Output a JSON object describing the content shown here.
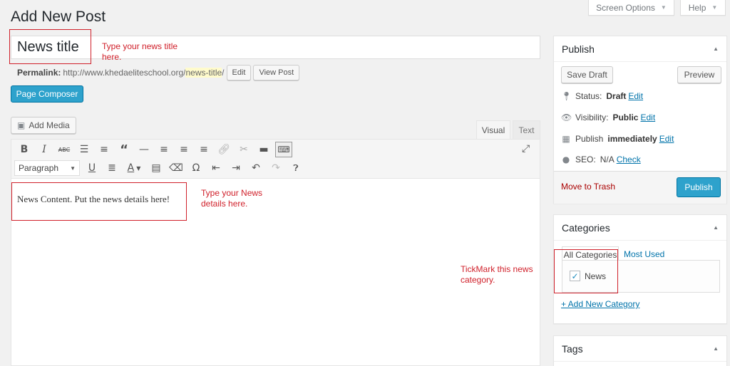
{
  "header": {
    "page_title": "Add New Post",
    "screen_options": "Screen Options",
    "help": "Help"
  },
  "post": {
    "title_value": "News title",
    "permalink_label": "Permalink:",
    "permalink_base": "http://www.khedaeliteschool.org/",
    "permalink_slug": "news-title",
    "permalink_trailing": "/",
    "edit_label": "Edit",
    "view_post_label": "View Post"
  },
  "page_composer": "Page Composer",
  "editor": {
    "add_media": "Add Media",
    "tab_visual": "Visual",
    "tab_text": "Text",
    "format_select": "Paragraph",
    "content": "News Content. Put the news details here!"
  },
  "annotations": {
    "title_note": "Type your news title here.",
    "content_note": "Type your News details here.",
    "category_note": "TickMark this news category."
  },
  "publish": {
    "heading": "Publish",
    "save_draft": "Save Draft",
    "preview": "Preview",
    "status_label": "Status:",
    "status_value": "Draft",
    "visibility_label": "Visibility:",
    "visibility_value": "Public",
    "publish_label": "Publish",
    "publish_value": "immediately",
    "seo_label": "SEO:",
    "seo_value": "N/A",
    "edit_link": "Edit",
    "check_link": "Check",
    "move_to_trash": "Move to Trash",
    "publish_button": "Publish"
  },
  "categories": {
    "heading": "Categories",
    "tab_all": "All Categories",
    "tab_most_used": "Most Used",
    "items": [
      {
        "label": "News",
        "checked": true
      }
    ],
    "add_new": "+ Add New Category"
  },
  "tags": {
    "heading": "Tags"
  }
}
